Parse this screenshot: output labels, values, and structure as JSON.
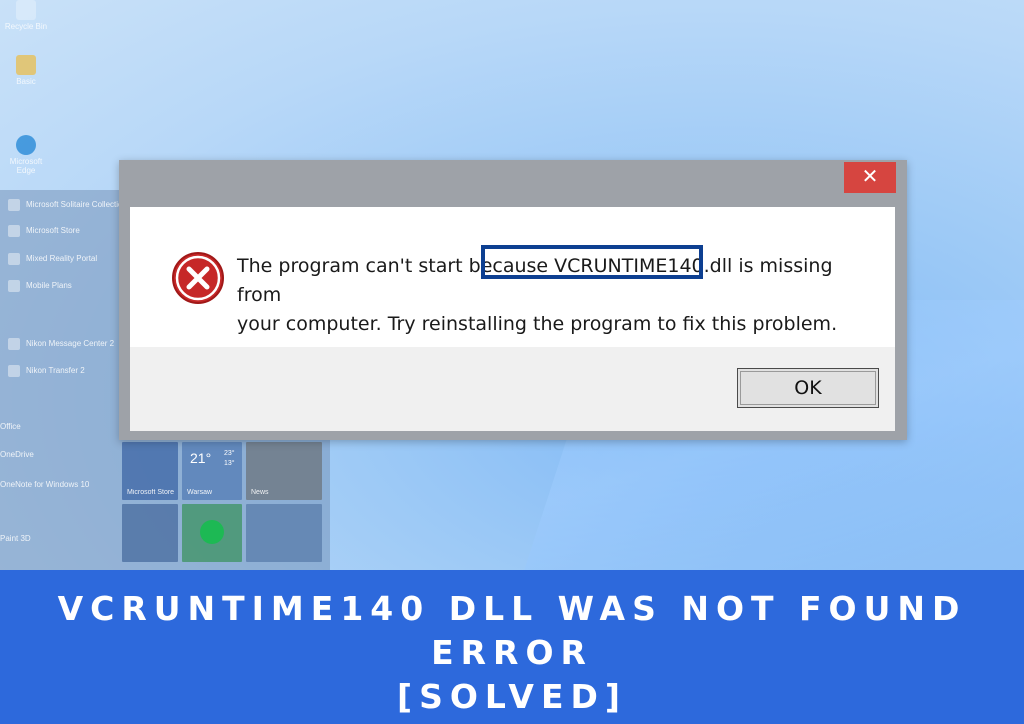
{
  "desktop": {
    "icons": [
      "Recycle Bin",
      "Basic",
      "Microsoft Edge"
    ],
    "start_menu_items": [
      "Microsoft Solitaire Collection",
      "Microsoft Store",
      "Mixed Reality Portal",
      "Mobile Plans",
      "Nikon Message Center 2",
      "Nikon Transfer 2",
      "Office",
      "OneDrive",
      "OneNote for Windows 10",
      "Paint 3D"
    ],
    "tiles": {
      "store": "Microsoft Store",
      "weather_temp": "21°",
      "weather_hi": "23°",
      "weather_lo": "13°",
      "weather_city": "Warsaw",
      "news": "News"
    }
  },
  "dialog": {
    "close_label": "✕",
    "message_line1": "The program can't start because VCRUNTIME140.dll is missing from",
    "message_line2": "your computer. Try reinstalling the program to fix this problem.",
    "ok_label": "OK",
    "icon": "error-icon",
    "colors": {
      "close": "#d64540",
      "highlight": "#0d3f91"
    }
  },
  "banner": {
    "line1": "VCRUNTIME140 DLL WAS NOT FOUND",
    "line2": "ERROR",
    "line3": "[SOLVED]",
    "color": "#2d69dc"
  }
}
